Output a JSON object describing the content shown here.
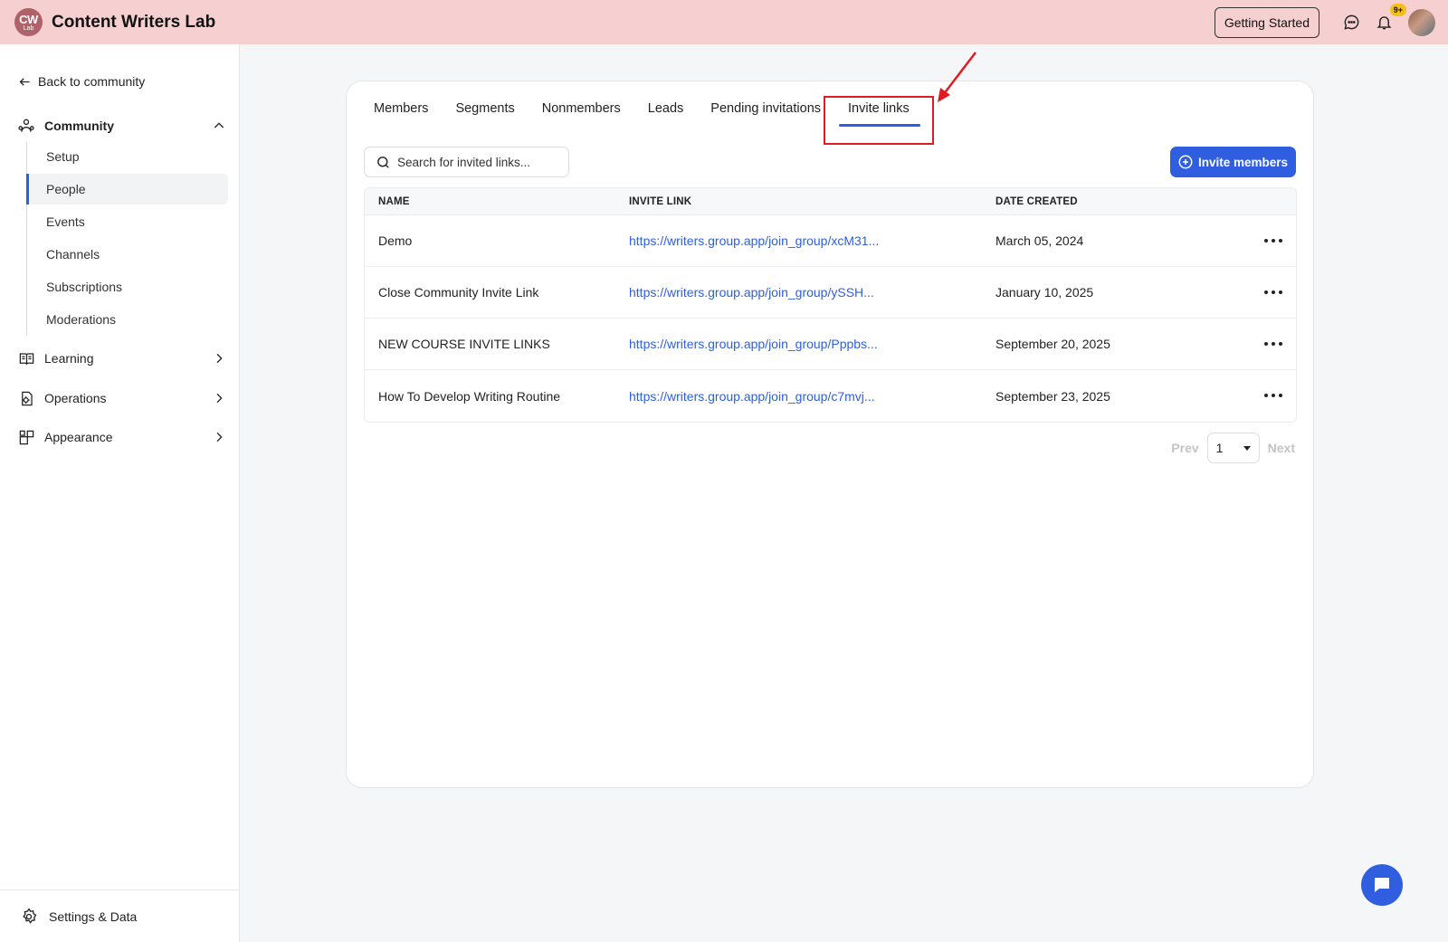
{
  "header": {
    "logo_line1": "CW",
    "logo_line2": "Lab",
    "app_title": "Content Writers Lab",
    "getting_started": "Getting Started",
    "notification_badge": "9+"
  },
  "sidebar": {
    "back_label": "Back to community",
    "community": {
      "label": "Community",
      "items": [
        {
          "label": "Setup"
        },
        {
          "label": "People"
        },
        {
          "label": "Events"
        },
        {
          "label": "Channels"
        },
        {
          "label": "Subscriptions"
        },
        {
          "label": "Moderations"
        }
      ]
    },
    "groups": [
      {
        "label": "Learning"
      },
      {
        "label": "Operations"
      },
      {
        "label": "Appearance"
      }
    ],
    "settings_label": "Settings & Data"
  },
  "main": {
    "tabs": [
      {
        "label": "Members"
      },
      {
        "label": "Segments"
      },
      {
        "label": "Nonmembers"
      },
      {
        "label": "Leads"
      },
      {
        "label": "Pending invitations"
      },
      {
        "label": "Invite links"
      }
    ],
    "search_placeholder": "Search for invited links...",
    "invite_button": "Invite members",
    "table": {
      "headers": [
        "NAME",
        "INVITE LINK",
        "DATE CREATED"
      ],
      "rows": [
        {
          "name": "Demo",
          "link": "https://writers.group.app/join_group/xcM31...",
          "date": "March 05, 2024"
        },
        {
          "name": "Close Community Invite Link",
          "link": "https://writers.group.app/join_group/ySSH...",
          "date": "January 10, 2025"
        },
        {
          "name": "NEW COURSE INVITE LINKS",
          "link": "https://writers.group.app/join_group/Pppbs...",
          "date": "September 20, 2025"
        },
        {
          "name": "How To Develop Writing Routine",
          "link": "https://writers.group.app/join_group/c7mvj...",
          "date": "September 23, 2025"
        }
      ]
    },
    "pagination": {
      "prev": "Prev",
      "page": "1",
      "next": "Next"
    }
  },
  "colors": {
    "header_bg": "#f6cfd1",
    "accent": "#2f5fe0",
    "highlight": "#e01b24"
  }
}
